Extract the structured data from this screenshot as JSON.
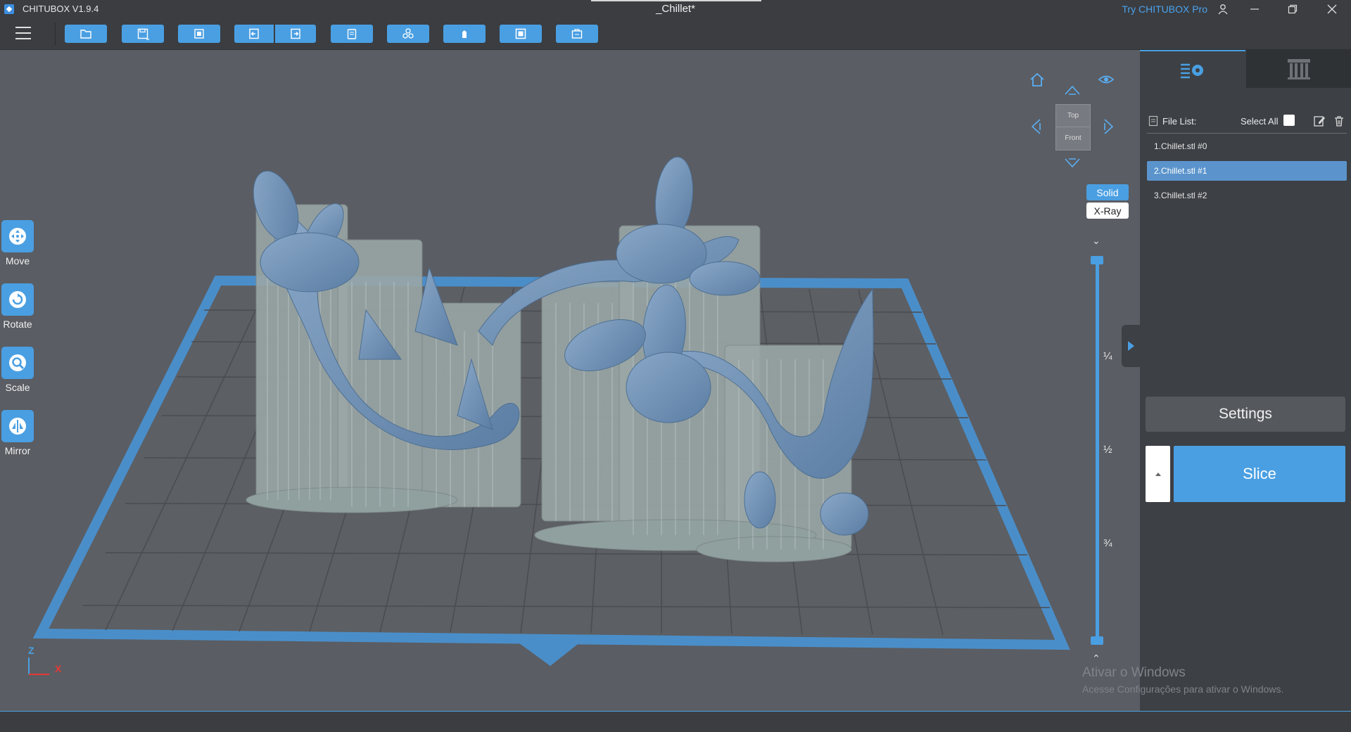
{
  "app": {
    "title": "CHITUBOX V1.9.4",
    "document_title": "_Chillet*",
    "try_pro": "Try CHITUBOX Pro"
  },
  "window_controls": [
    "user-icon",
    "minimize-icon",
    "restore-icon",
    "close-icon"
  ],
  "toolbar": {
    "buttons": [
      "open-file-icon",
      "save-icon",
      "import-icon",
      "undo-icon",
      "redo-icon",
      "clipboard-icon",
      "duplicate-icon",
      "support-icon",
      "hollow-icon",
      "drill-icon"
    ]
  },
  "tools": {
    "move": "Move",
    "rotate": "Rotate",
    "scale": "Scale",
    "mirror": "Mirror"
  },
  "view": {
    "cube_top": "Top",
    "cube_front": "Front",
    "solid": "Solid",
    "xray": "X-Ray",
    "slider_marks": [
      "¼",
      "½",
      "¾"
    ]
  },
  "axis": {
    "z": "Z",
    "x": "X"
  },
  "panel": {
    "file_list_label": "File List:",
    "select_all_label": "Select All",
    "files": [
      "1.Chillet.stl #0",
      "2.Chillet.stl #1",
      "3.Chillet.stl #2"
    ],
    "selected_index": 1,
    "settings_label": "Settings",
    "slice_label": "Slice"
  },
  "watermark": {
    "title": "Ativar o Windows",
    "subtitle": "Acesse Configurações para ativar o Windows."
  },
  "colors": {
    "accent": "#4a9fe2",
    "model": "#6e8fb3",
    "supports": "#9aa7a6",
    "plate_border": "#4a8ec9"
  }
}
